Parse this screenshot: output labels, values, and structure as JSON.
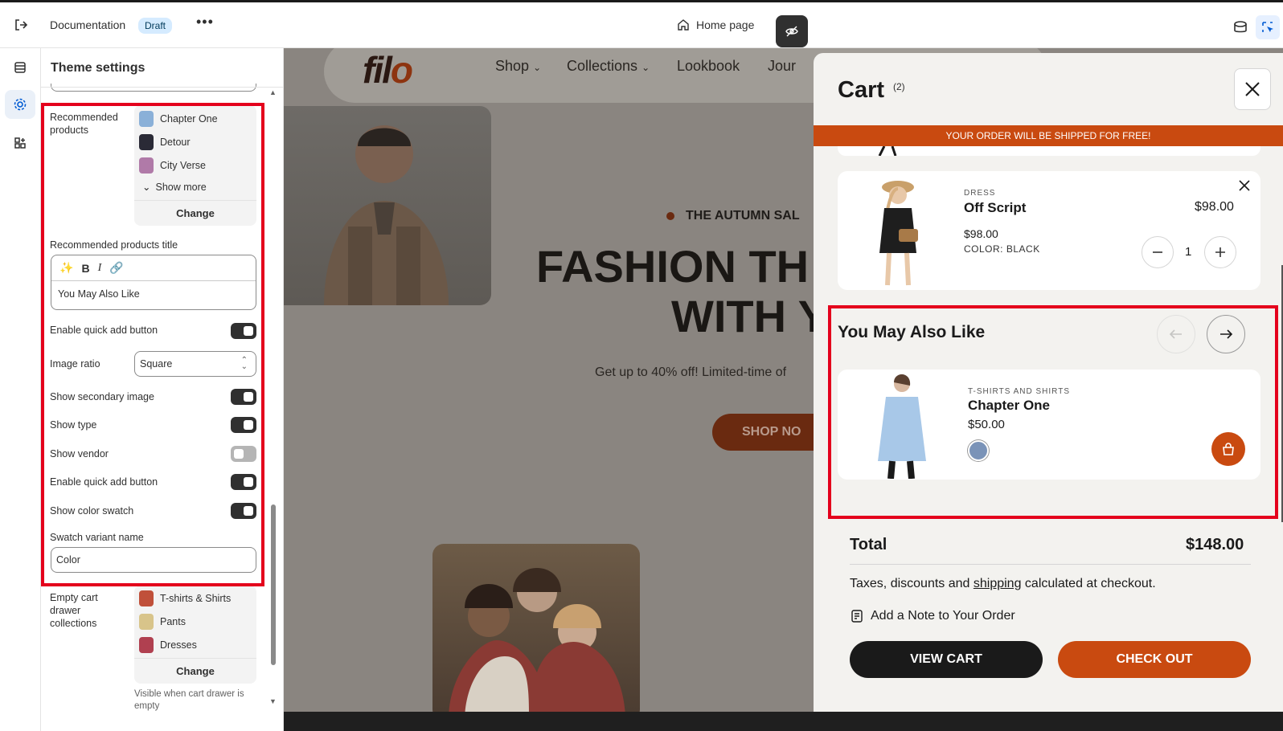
{
  "topbar": {
    "doc_title": "Documentation",
    "badge": "Draft",
    "more": "•••",
    "page_selector": "Home page"
  },
  "panel": {
    "title": "Theme settings",
    "recommended_label": "Recommended products",
    "recommended_items": [
      {
        "name": "Chapter One",
        "color": "#8ab0d8"
      },
      {
        "name": "Detour",
        "color": "#2a2a36"
      },
      {
        "name": "City Verse",
        "color": "#b07aa8"
      }
    ],
    "show_more": "Show more",
    "change": "Change",
    "rec_title_label": "Recommended products title",
    "rec_title_value": "You May Also Like",
    "quick_add_label": "Enable quick add button",
    "image_ratio_label": "Image ratio",
    "image_ratio_value": "Square",
    "secondary_image_label": "Show secondary image",
    "show_type_label": "Show type",
    "show_vendor_label": "Show vendor",
    "quick_add_label_2": "Enable quick add button",
    "color_swatch_label": "Show color swatch",
    "swatch_name_label": "Swatch variant name",
    "swatch_name_value": "Color",
    "empty_cart_label": "Empty cart drawer collections",
    "empty_items": [
      {
        "name": "T-shirts & Shirts",
        "color": "#c0503a"
      },
      {
        "name": "Pants",
        "color": "#d8c48a"
      },
      {
        "name": "Dresses",
        "color": "#b04050"
      }
    ],
    "change2": "Change",
    "help": "Visible when cart drawer is empty",
    "toggles": {
      "quick_add": true,
      "secondary_image": true,
      "show_type": true,
      "show_vendor": false,
      "quick_add_2": true,
      "color_swatch": true
    }
  },
  "preview": {
    "logo_a": "fil",
    "logo_b": "o",
    "nav": [
      "Shop",
      "Collections",
      "Lookbook",
      "Jour"
    ],
    "autumn": "THE AUTUMN SAL",
    "headline_1": "FASHION TH",
    "headline_2": "WITH Y",
    "subtitle": "Get up to 40% off! Limited-time of",
    "shop_button": "SHOP NO"
  },
  "cart": {
    "title": "Cart",
    "count": "(2)",
    "shipping_banner": "YOUR ORDER WILL BE SHIPPED FOR FREE!",
    "item": {
      "type": "DRESS",
      "name": "Off Script",
      "price_right": "$98.00",
      "price": "$98.00",
      "color": "COLOR: BLACK",
      "qty": "1"
    },
    "recommend_title": "You May Also Like",
    "rec_product": {
      "type": "T-SHIRTS AND SHIRTS",
      "name": "Chapter One",
      "price": "$50.00",
      "swatch_color": "#7a93b8"
    },
    "total_label": "Total",
    "total_value": "$148.00",
    "taxes_pre": "Taxes, discounts and ",
    "taxes_link": "shipping",
    "taxes_post": " calculated at checkout.",
    "note": "Add a Note to Your Order",
    "view_cart": "VIEW CART",
    "checkout": "CHECK OUT"
  },
  "colors": {
    "accent": "#c94a10",
    "highlight": "#e4001c"
  }
}
